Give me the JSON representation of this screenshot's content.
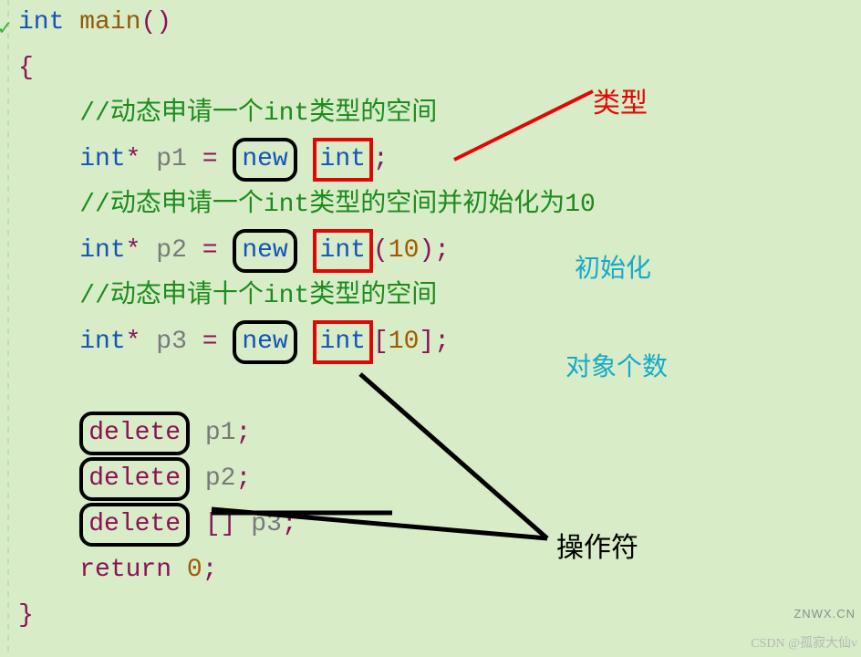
{
  "code": {
    "l1_int": "int",
    "l1_main": "main",
    "l1_par": "()",
    "l2": "{",
    "indent": "    ",
    "c1": "//动态申请一个int类型的空间",
    "l3_int": "int",
    "l3_star": "*",
    "l3_p1": "p1",
    "l3_eq": "=",
    "l3_new": "new",
    "l3_type": "int",
    "l3_semi": ";",
    "c2": "//动态申请一个int类型的空间并初始化为10",
    "l4_int": "int",
    "l4_star": "*",
    "l4_p2": "p2",
    "l4_eq": "=",
    "l4_new": "new",
    "l4_type": "int",
    "l4_open": "(",
    "l4_num": "10",
    "l4_close": ")",
    "l4_semi": ";",
    "c3": "//动态申请十个int类型的空间",
    "l5_int": "int",
    "l5_star": "*",
    "l5_p3": "p3",
    "l5_eq": "=",
    "l5_new": "new",
    "l5_type": "int",
    "l5_lb": "[",
    "l5_num": "10",
    "l5_rb": "]",
    "l5_semi": ";",
    "d1": "delete",
    "d1_p": "p1",
    "d2": "delete",
    "d2_p": "p2",
    "d3": "delete",
    "d3_br": "[]",
    "d3_p": "p3",
    "ret": "return",
    "zero": "0",
    "semi": ";",
    "close": "}"
  },
  "annotations": {
    "type": "类型",
    "init": "初始化",
    "count": "对象个数",
    "operator": "操作符"
  },
  "watermark": {
    "a": "ZNWX.CN",
    "b": "CSDN @孤寂大仙v"
  }
}
